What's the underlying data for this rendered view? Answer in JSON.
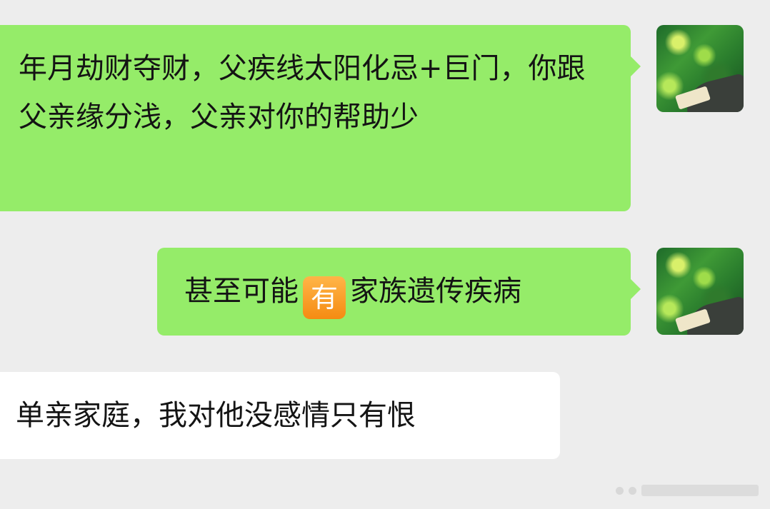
{
  "messages": [
    {
      "sender": "self",
      "text": "年月劫财夺财，父疾线太阳化忌+巨门，你跟父亲缘分浅，父亲对你的帮助少"
    },
    {
      "sender": "self",
      "text_before": "甚至可能",
      "emoji": "有",
      "text_after": "家族遗传疾病"
    },
    {
      "sender": "other",
      "text": "单亲家庭，我对他没感情只有恨"
    }
  ],
  "colors": {
    "background": "#ededed",
    "self_bubble": "#95ec69",
    "other_bubble": "#ffffff"
  },
  "icons": {
    "avatar": "landscape-avatar",
    "emoji": "orange-square-you-emoji"
  }
}
